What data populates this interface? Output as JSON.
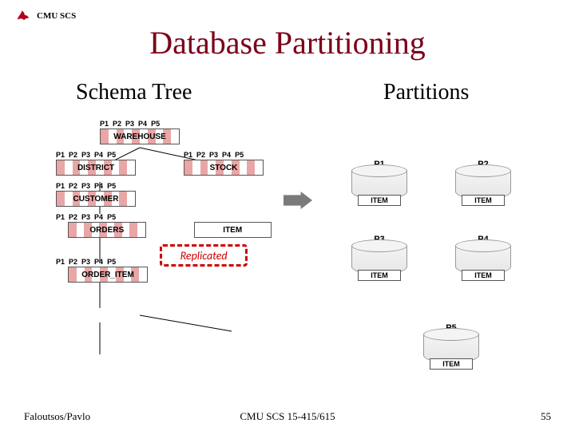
{
  "header": {
    "org": "CMU SCS"
  },
  "title": "Database Partitioning",
  "subtitle_left": "Schema Tree",
  "subtitle_right": "Partitions",
  "plabels": [
    "P1",
    "P2",
    "P3",
    "P4",
    "P5"
  ],
  "tree": {
    "warehouse": "WAREHOUSE",
    "district": "DISTRICT",
    "stock": "STOCK",
    "customer": "CUSTOMER",
    "orders": "ORDERS",
    "order_item": "ORDER_ITEM",
    "item": "ITEM",
    "replicated": "Replicated"
  },
  "partitions_grid": {
    "p1": "P1",
    "p2": "P2",
    "p3": "P3",
    "p4": "P4",
    "p5": "P5",
    "item_label": "ITEM"
  },
  "footer": {
    "left": "Faloutsos/Pavlo",
    "center": "CMU SCS 15-415/615",
    "right": "55"
  }
}
